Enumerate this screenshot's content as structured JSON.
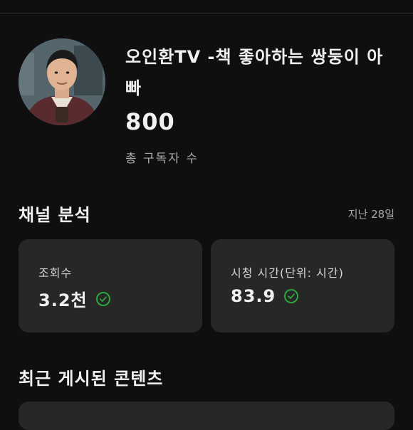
{
  "channel": {
    "title": "오인환TV -책 좋아하는 쌍둥이 아빠",
    "subscriber_count": "800",
    "subscriber_label": "총 구독자 수"
  },
  "analytics": {
    "section_title": "채널 분석",
    "period": "지난 28일",
    "cards": [
      {
        "label": "조회수",
        "value": "3.2천",
        "status_icon": "check-circle-icon"
      },
      {
        "label": "시청 시간(단위: 시간)",
        "value": "83.9",
        "status_icon": "check-circle-icon"
      }
    ]
  },
  "recent": {
    "section_title": "최근 게시된 콘텐츠"
  },
  "colors": {
    "background": "#0f0f0f",
    "card": "#272727",
    "accent_green": "#2ba640"
  }
}
